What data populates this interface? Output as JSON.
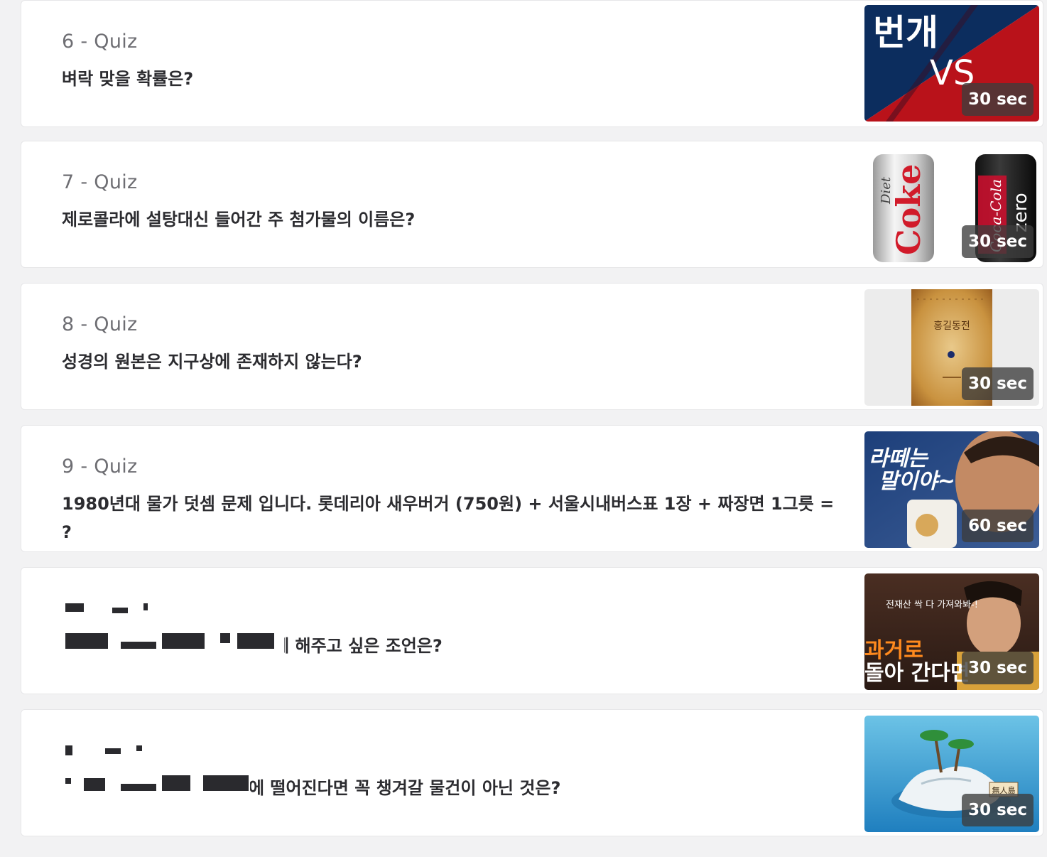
{
  "quizzes": [
    {
      "number": "6 - Quiz",
      "question": "벼락 맞을 확률은?",
      "timer": "30 sec",
      "thumbnail": {
        "text_top": "번개",
        "text_bottom": "VS",
        "colors": [
          "#0c2d5e",
          "#c0141b"
        ]
      }
    },
    {
      "number": "7 - Quiz",
      "question": "제로콜라에 설탕대신 들어간 주 첨가물의 이름은?",
      "timer": "30 sec",
      "thumbnail": {
        "can_left": "Coke",
        "can_left_small": "Diet",
        "can_right": "zero",
        "can_right_small": "Coca-Cola"
      }
    },
    {
      "number": "8 - Quiz",
      "question": "성경의 원본은 지구상에 존재하지 않는다?",
      "timer": "30 sec",
      "thumbnail": {
        "book_title": "홍길동전"
      }
    },
    {
      "number": "9 - Quiz",
      "question": "1980년대 물가 덧셈 문제 입니다. 롯데리아 새우버거 (750원) + 서울시내버스표 1장 + 짜장면 1그릇 = ?",
      "timer": "60 sec",
      "thumbnail": {
        "caption_line1": "라떼는",
        "caption_line2": "말이야~"
      }
    },
    {
      "number": "",
      "question": "에게 해주고 싶은 조언은?",
      "timer": "30 sec",
      "thumbnail": {
        "caption_top": "전재산 싹 다 가져와봐-!",
        "caption_line1": "과거로",
        "caption_line2": "돌아 간다면"
      }
    },
    {
      "number": "",
      "question": "에 떨어진다면 꼭 챙겨갈 물건이 아닌 것은?",
      "timer": "30 sec",
      "thumbnail": {
        "sign": "無人島"
      }
    }
  ]
}
